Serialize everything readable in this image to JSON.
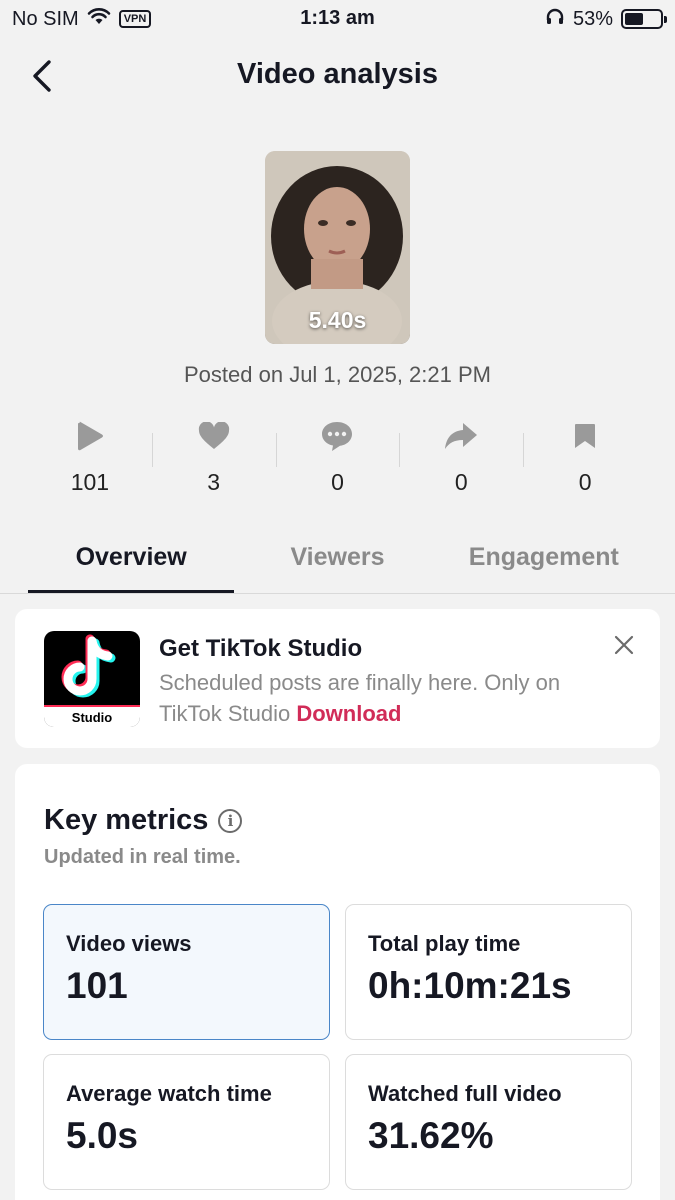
{
  "status_bar": {
    "carrier": "No SIM",
    "vpn": "VPN",
    "time": "1:13 am",
    "battery": "53%",
    "battery_level": 0.53
  },
  "header": {
    "title": "Video analysis"
  },
  "video": {
    "duration": "5.40s",
    "posted": "Posted on Jul 1, 2025, 2:21 PM"
  },
  "stats": [
    {
      "icon": "play-icon",
      "value": "101"
    },
    {
      "icon": "heart-icon",
      "value": "3"
    },
    {
      "icon": "comment-icon",
      "value": "0"
    },
    {
      "icon": "share-icon",
      "value": "0"
    },
    {
      "icon": "bookmark-icon",
      "value": "0"
    }
  ],
  "tabs": [
    {
      "label": "Overview",
      "active": true
    },
    {
      "label": "Viewers",
      "active": false
    },
    {
      "label": "Engagement",
      "active": false
    }
  ],
  "studio_promo": {
    "logo_text": "Studio",
    "title": "Get TikTok Studio",
    "description": "Scheduled posts are finally here. Only on TikTok Studio ",
    "download": "Download"
  },
  "key_metrics": {
    "title": "Key metrics",
    "subtitle": "Updated in real time.",
    "items": [
      {
        "label": "Video views",
        "value": "101"
      },
      {
        "label": "Total play time",
        "value": "0h:10m:21s"
      },
      {
        "label": "Average watch time",
        "value": "5.0s"
      },
      {
        "label": "Watched full video",
        "value": "31.62%"
      }
    ]
  },
  "colors": {
    "accent": "#d12c58",
    "background": "#f2f2f2",
    "text": "#161823"
  }
}
